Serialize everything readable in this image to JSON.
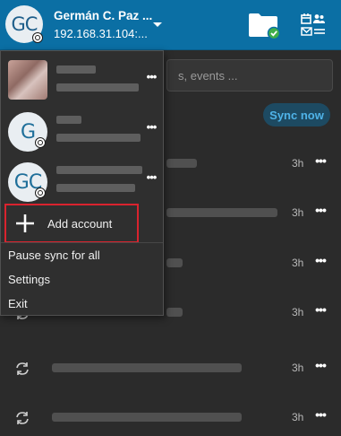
{
  "header": {
    "avatar_initials": "GC",
    "user_name": "Germán C. Paz ...",
    "server": "192.168.31.104:...",
    "folder_icon": "folder-synced-icon",
    "apps_icon": "apps-calendar-contacts-mail-icon"
  },
  "main": {
    "search_placeholder": "s, events ...",
    "sync_now_label": "Sync now",
    "activities": [
      {
        "time": "3h"
      },
      {
        "time": "3h"
      },
      {
        "time": "3h"
      },
      {
        "time": "3h"
      },
      {
        "time": "3h"
      },
      {
        "time": "3h"
      }
    ],
    "more_label": "•••"
  },
  "menu": {
    "accounts": [
      {
        "initials": "",
        "type": "photo"
      },
      {
        "initials": "G",
        "type": "letter"
      },
      {
        "initials": "GC",
        "type": "letter"
      }
    ],
    "more_label": "•••",
    "add_account_label": "Add account",
    "pause_sync_label": "Pause sync for all",
    "settings_label": "Settings",
    "exit_label": "Exit"
  },
  "colors": {
    "header_bg": "#0b6fa4",
    "panel_bg": "#2b2b2b",
    "highlight_border": "#d9232e",
    "sync_now_text": "#4fb3e8"
  }
}
